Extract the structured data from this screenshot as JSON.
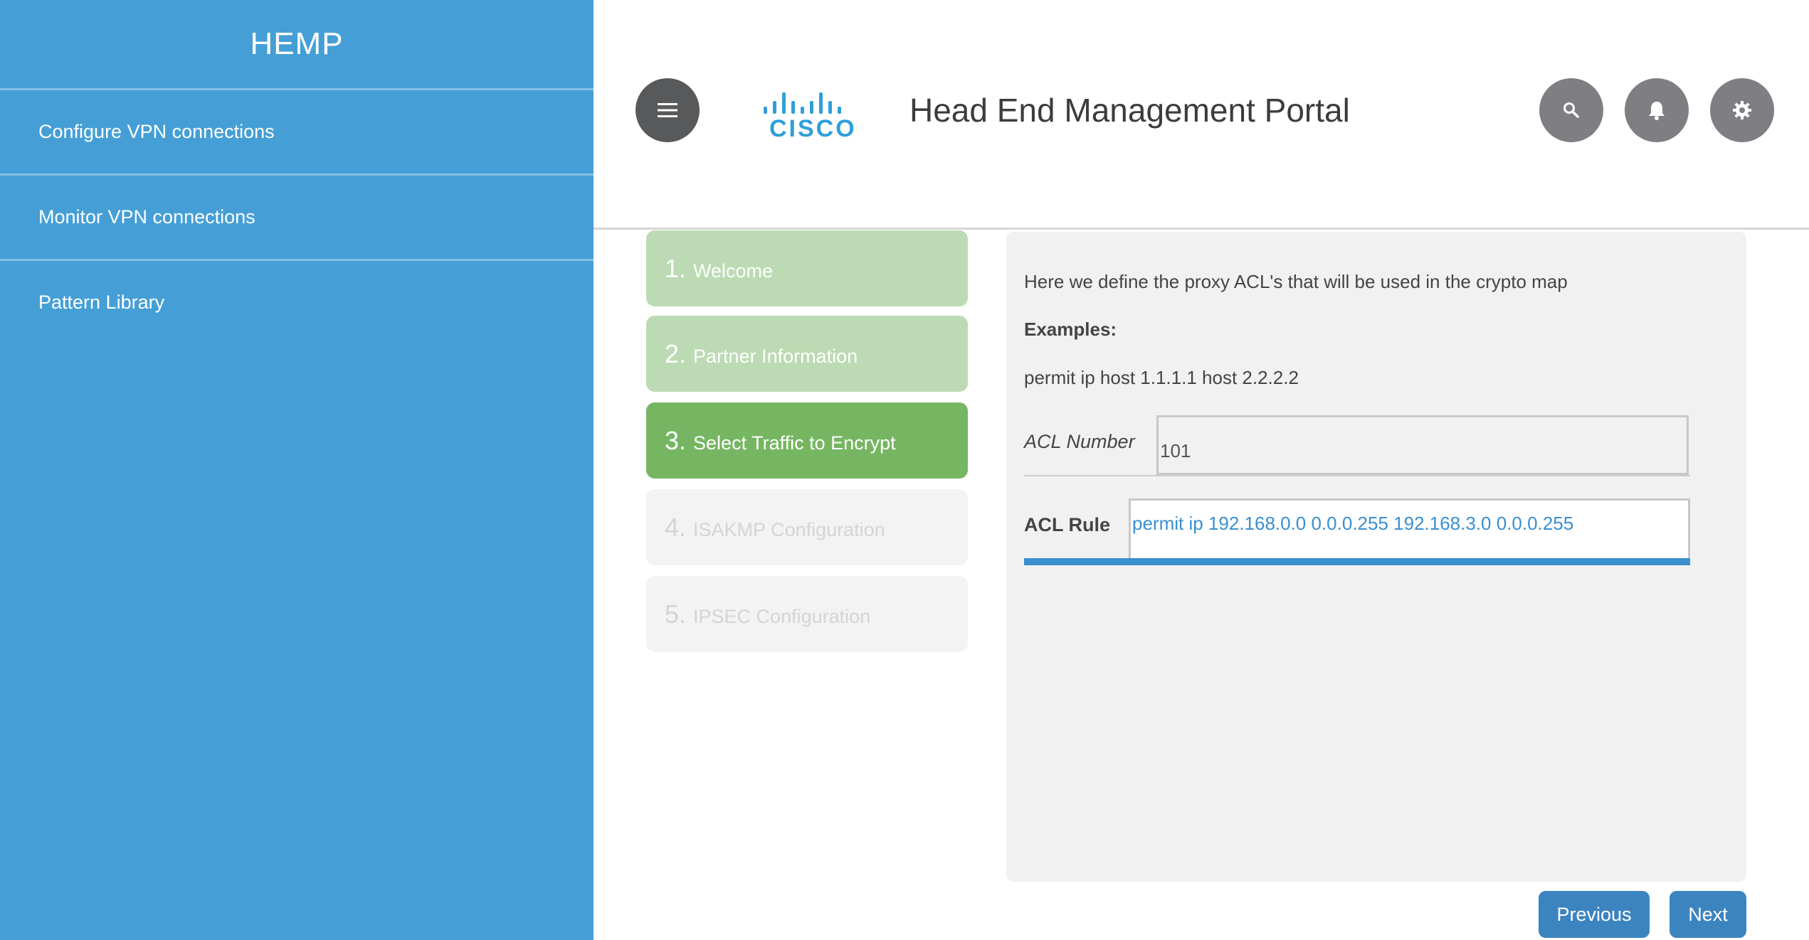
{
  "sidebar": {
    "brand": "HEMP",
    "items": [
      {
        "label": "Configure VPN connections"
      },
      {
        "label": "Monitor VPN connections"
      },
      {
        "label": "Pattern Library"
      }
    ]
  },
  "header": {
    "logo_text": "CISCO",
    "title": "Head End Management Portal",
    "icons": [
      "hamburger-menu-icon",
      "search-icon",
      "bell-icon",
      "gear-icon"
    ]
  },
  "steps": [
    {
      "num": "1.",
      "label": "Welcome",
      "state": "done"
    },
    {
      "num": "2.",
      "label": "Partner Information",
      "state": "done"
    },
    {
      "num": "3.",
      "label": "Select Traffic to Encrypt",
      "state": "active"
    },
    {
      "num": "4.",
      "label": "ISAKMP Configuration",
      "state": "pending"
    },
    {
      "num": "5.",
      "label": "IPSEC Configuration",
      "state": "pending"
    }
  ],
  "panel": {
    "intro": "Here we define the proxy ACL's that will be used in the crypto map",
    "examples_label": "Examples:",
    "example_line": "permit ip host 1.1.1.1 host 2.2.2.2",
    "acl_number": {
      "label": "ACL Number",
      "value": "101"
    },
    "acl_rule": {
      "label": "ACL Rule",
      "value": "permit ip 192.168.0.0 0.0.0.255 192.168.3.0 0.0.0.255"
    }
  },
  "footer": {
    "previous_label": "Previous",
    "next_label": "Next"
  },
  "colors": {
    "sidebar_bg": "#459fd6",
    "step_done": "#bcdbb4",
    "step_active": "#76b662",
    "step_pending": "#f3f3f3",
    "accent": "#3a8fcf",
    "button": "#3c84c0"
  }
}
